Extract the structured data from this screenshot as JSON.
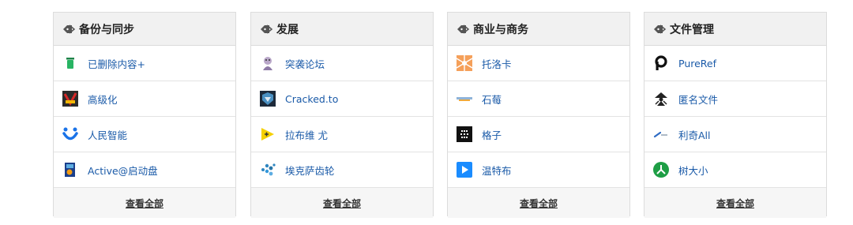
{
  "cards": [
    {
      "title": "备份与同步",
      "items": [
        {
          "label": "已删除内容+",
          "icon": "green-trash-icon"
        },
        {
          "label": "高级化",
          "icon": "advanced-check-icon"
        },
        {
          "label": "人民智能",
          "icon": "blue-u-icon"
        },
        {
          "label": "Active@启动盘",
          "icon": "boot-disk-icon"
        }
      ],
      "see_all": "查看全部"
    },
    {
      "title": "发展",
      "items": [
        {
          "label": "突袭论坛",
          "icon": "forum-avatar-icon"
        },
        {
          "label": "Cracked.to",
          "icon": "cracked-to-icon"
        },
        {
          "label": "拉布维 尤",
          "icon": "yellow-play-icon"
        },
        {
          "label": "埃克萨齿轮",
          "icon": "blue-dots-icon"
        }
      ],
      "see_all": "查看全部"
    },
    {
      "title": "商业与商务",
      "items": [
        {
          "label": "托洛卡",
          "icon": "orange-sunburst-icon"
        },
        {
          "label": "石莓",
          "icon": "stoneberry-logo-icon"
        },
        {
          "label": "格子",
          "icon": "plaid-grid-icon"
        },
        {
          "label": "温特布",
          "icon": "blue-play-icon"
        }
      ],
      "see_all": "查看全部"
    },
    {
      "title": "文件管理",
      "items": [
        {
          "label": "PureRef",
          "icon": "pureref-p-icon"
        },
        {
          "label": "匿名文件",
          "icon": "anonymous-figure-icon"
        },
        {
          "label": "利奇All",
          "icon": "pen-line-icon"
        },
        {
          "label": "树大小",
          "icon": "green-tree-icon"
        }
      ],
      "see_all": "查看全部"
    }
  ]
}
